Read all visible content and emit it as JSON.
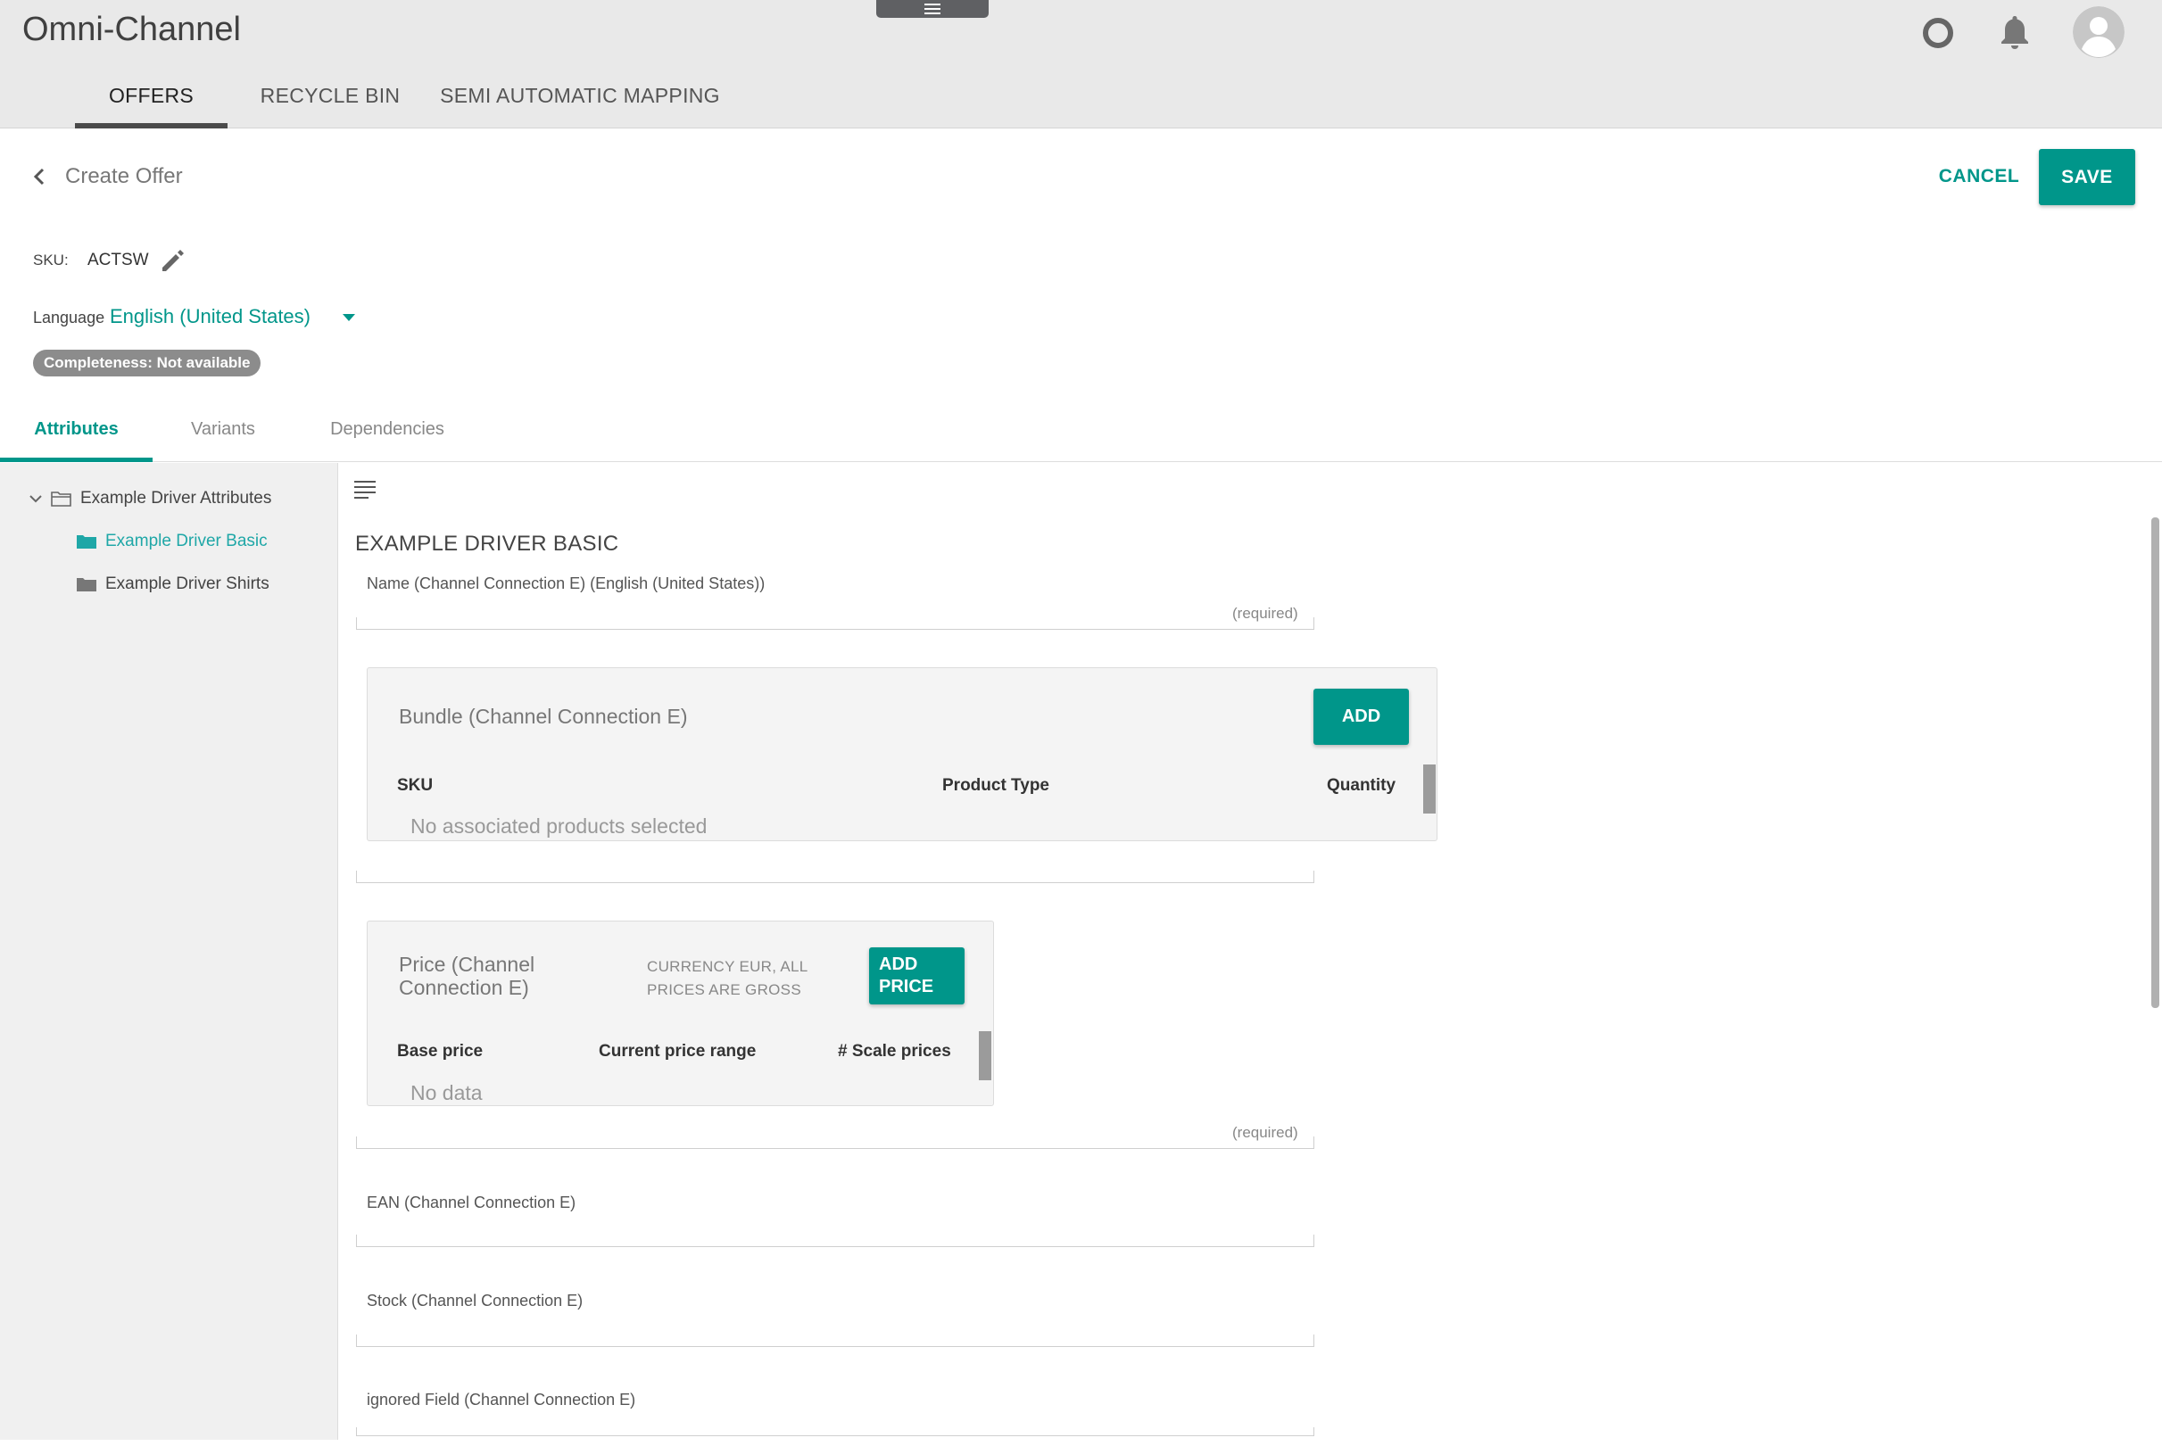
{
  "header": {
    "app_title": "Omni-Channel",
    "icons": [
      "menu-icon",
      "status-icon",
      "bell-icon",
      "user-avatar-icon"
    ],
    "tabs": [
      {
        "label": "OFFERS",
        "active": true
      },
      {
        "label": "RECYCLE BIN",
        "active": false
      },
      {
        "label": "SEMI AUTOMATIC MAPPING",
        "active": false
      }
    ]
  },
  "page": {
    "title": "Create Offer",
    "cancel_label": "CANCEL",
    "save_label": "SAVE",
    "sku_label": "SKU:",
    "sku_value": "ACTSW",
    "language_label": "Language",
    "language_value": "English (United States)",
    "completeness": "Completeness: Not available"
  },
  "sub_tabs": [
    {
      "label": "Attributes",
      "active": true
    },
    {
      "label": "Variants",
      "active": false
    },
    {
      "label": "Dependencies",
      "active": false
    }
  ],
  "tree": {
    "root": "Example Driver Attributes",
    "children": [
      {
        "label": "Example Driver Basic",
        "selected": true
      },
      {
        "label": "Example Driver Shirts",
        "selected": false
      }
    ]
  },
  "section": {
    "title": "EXAMPLE DRIVER BASIC",
    "name_field": {
      "label": "Name (Channel Connection E) (English (United States))",
      "hint": "(required)"
    },
    "bundle": {
      "title": "Bundle (Channel Connection E)",
      "add_label": "ADD",
      "columns": [
        "SKU",
        "Product Type",
        "Quantity"
      ],
      "empty": "No associated products selected"
    },
    "price": {
      "title_line1": "Price (Channel",
      "title_line2": "Connection E)",
      "note_line1": "CURRENCY EUR, ALL",
      "note_line2": "PRICES ARE GROSS",
      "add_line1": "ADD",
      "add_line2": "PRICE",
      "columns": [
        "Base price",
        "Current price range",
        "# Scale prices"
      ],
      "empty": "No data",
      "hint": "(required)"
    },
    "ean_label": "EAN (Channel Connection E)",
    "stock_label": "Stock (Channel Connection E)",
    "ignored_label": "ignored Field (Channel Connection E)"
  },
  "colors": {
    "accent": "#00968a",
    "header_bg": "#e9e9e9",
    "tree_bg": "#f0f0f0",
    "badge_bg": "#8c8c8c"
  }
}
